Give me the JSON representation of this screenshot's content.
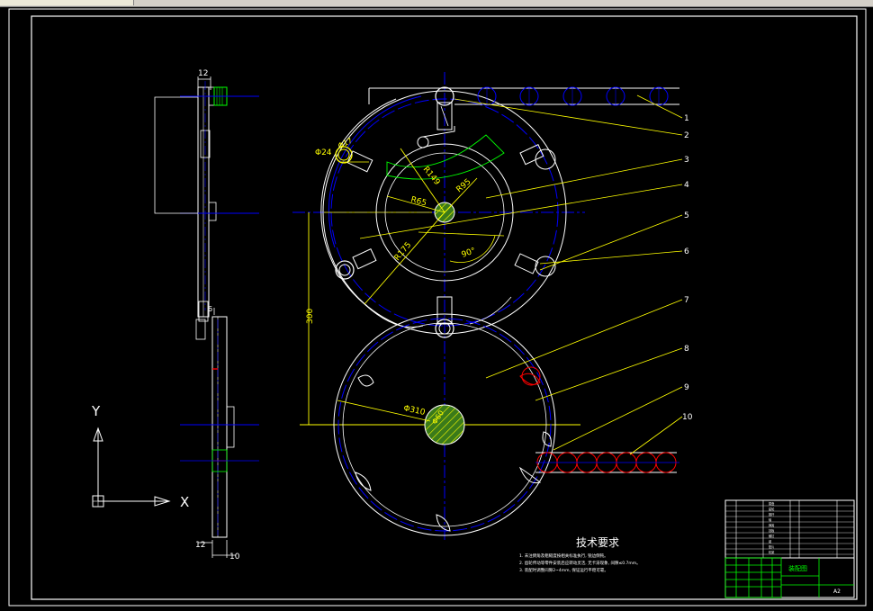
{
  "side_view": {
    "dim_top": "12",
    "dim_mid": "6",
    "dim_bottom_left": "12",
    "dim_bottom_right": "10"
  },
  "dimensions": {
    "phi24": "Φ24",
    "phi17": "Φ17",
    "r149": "R149",
    "r95": "R95",
    "r65": "R65",
    "r175": "R175",
    "angle90": "90°",
    "d300": "300",
    "phi310": "Φ310",
    "phi60": "Φ60"
  },
  "callouts": [
    "1",
    "2",
    "3",
    "4",
    "5",
    "6",
    "7",
    "8",
    "9",
    "10"
  ],
  "ucs": {
    "x": "X",
    "y": "Y"
  },
  "notes": {
    "title": "技术要求",
    "lines": [
      "1. 未注倒角及粗糙度按相关标准执行, 锐边倒钝。",
      "2. 齿轮传动等零件安装后应转动灵活, 无卡滞现象, 间隙≤0.7mm。",
      "3. 装配时调整间隙2~4mm, 保证运行平稳可靠。"
    ]
  },
  "title_block": {
    "drawing_name": "装配图",
    "sheet": "A2",
    "rows": [
      "拨盘",
      "星轮",
      "推杆",
      "轴",
      "弹簧",
      "挡板",
      "螺钉",
      "键",
      "垫片",
      "机架"
    ]
  },
  "colors": {
    "white": "#ffffff",
    "yellow": "#ffff00",
    "blue": "#0000ff",
    "green": "#00ff00",
    "red": "#ff0000",
    "hatch_fill": "#55aa33"
  }
}
